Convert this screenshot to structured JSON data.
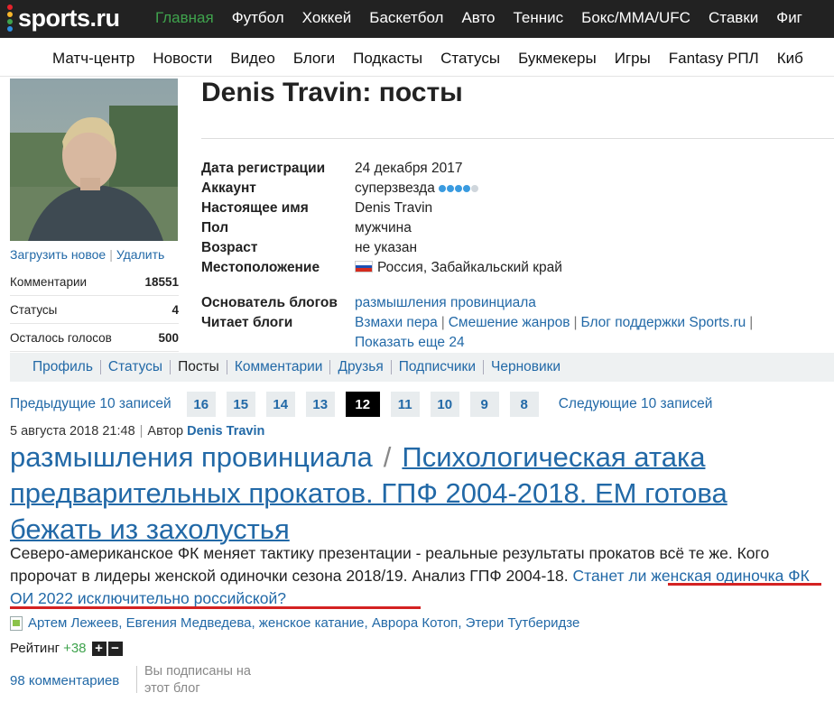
{
  "site": {
    "logo_text": "sports.ru",
    "logo_colors": [
      "#e6232c",
      "#f7b62b",
      "#3fa34d",
      "#2f8fe0"
    ],
    "main_nav": [
      {
        "label": "Главная",
        "active": true
      },
      {
        "label": "Футбол"
      },
      {
        "label": "Хоккей"
      },
      {
        "label": "Баскетбол"
      },
      {
        "label": "Авто"
      },
      {
        "label": "Теннис"
      },
      {
        "label": "Бокс/MMA/UFC"
      },
      {
        "label": "Ставки"
      },
      {
        "label": "Фиг"
      }
    ],
    "sub_nav": [
      "Матч-центр",
      "Новости",
      "Видео",
      "Блоги",
      "Подкасты",
      "Статусы",
      "Букмекеры",
      "Игры",
      "Fantasy РПЛ",
      "Киб"
    ]
  },
  "profile": {
    "title": "Denis Travin: посты",
    "upload_new": "Загрузить новое",
    "delete": "Удалить",
    "stats": [
      {
        "label": "Комментарии",
        "value": "18551"
      },
      {
        "label": "Статусы",
        "value": "4"
      },
      {
        "label": "Осталось голосов",
        "value": "500"
      }
    ],
    "info": {
      "reg_label": "Дата регистрации",
      "reg_value": "24 декабря 2017",
      "account_label": "Аккаунт",
      "account_value": "суперзвезда",
      "account_level": 4,
      "account_max": 5,
      "realname_label": "Настоящее имя",
      "realname_value": "Denis Travin",
      "gender_label": "Пол",
      "gender_value": "мужчина",
      "age_label": "Возраст",
      "age_value": "не указан",
      "location_label": "Местоположение",
      "location_value": "Россия, Забайкальский край"
    },
    "blogs": {
      "founder_label": "Основатель блогов",
      "founder_blog": "размышления провинциала",
      "reads_label": "Читает блоги",
      "reads": [
        "Взмахи пера",
        "Смешение жанров",
        "Блог поддержки Sports.ru"
      ],
      "show_more": "Показать еще 24"
    },
    "tabs": [
      {
        "label": "Профиль"
      },
      {
        "label": "Статусы"
      },
      {
        "label": "Посты",
        "current": true
      },
      {
        "label": "Комментарии"
      },
      {
        "label": "Друзья"
      },
      {
        "label": "Подписчики"
      },
      {
        "label": "Черновики"
      }
    ]
  },
  "pager": {
    "prev": "Предыдущие 10 записей",
    "pages": [
      "16",
      "15",
      "14",
      "13",
      "12",
      "11",
      "10",
      "9",
      "8"
    ],
    "current": "12",
    "next": "Следующие 10 записей"
  },
  "post": {
    "date": "5 августа 2018 21:48",
    "author_label": "Автор",
    "author": "Denis Travin",
    "blog": "размышления провинциала",
    "separator": "/",
    "title": "Психологическая атака предварительных прокатов. ГПФ 2004-2018. ЕМ готова бежать из захолустья",
    "lead_plain": "Северо-американское ФК меняет тактику презентации - реальные результаты прокатов всё те же. Кого пророчат в лидеры женской одиночки сезона 2018/19. Анализ ГПФ 2004-18. ",
    "lead_link": "Станет ли женская одиночка ФК ОИ 2022 исключительно российской?",
    "tags": [
      "Артем Лежеев",
      "Евгения Медведева",
      "женское катание",
      "Аврора Котоп",
      "Этери Тутберидзе"
    ],
    "rating_label": "Рейтинг",
    "rating_value": "+38",
    "comments": "98 комментариев",
    "subscribed": "Вы подписаны на этот блог"
  }
}
